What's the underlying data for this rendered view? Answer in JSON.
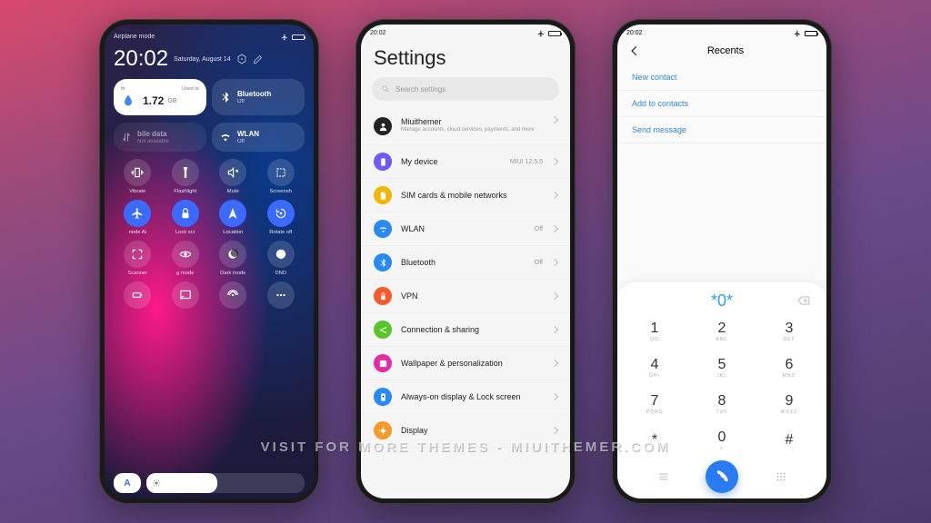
{
  "watermark": "VISIT FOR MORE THEMES - MIUITHEMER.COM",
  "qs": {
    "status_left": "Airplane mode",
    "clock": "20:02",
    "date": "Saturday, August 14",
    "data_tile": {
      "top_left": "th",
      "top_right": "Used to",
      "value": "1.72",
      "unit": "GB"
    },
    "bluetooth_tile": {
      "title": "Bluetooth",
      "sub": "Off"
    },
    "mobile_tile": {
      "title": "bile data",
      "sub": "Not available"
    },
    "wlan_tile": {
      "title": "WLAN",
      "sub": "Off"
    },
    "grid": [
      {
        "label": "Vibrate",
        "on": false,
        "icon": "vibrate"
      },
      {
        "label": "Flashlight",
        "on": false,
        "icon": "flashlight"
      },
      {
        "label": "Mute",
        "on": false,
        "icon": "mute"
      },
      {
        "label": "Screensh",
        "on": false,
        "icon": "screenshot"
      },
      {
        "label": "node   Ai",
        "on": true,
        "icon": "airplane"
      },
      {
        "label": "Lock scr",
        "on": true,
        "icon": "lock"
      },
      {
        "label": "Location",
        "on": true,
        "icon": "location"
      },
      {
        "label": "Rotate off",
        "on": true,
        "icon": "rotate"
      },
      {
        "label": "Scanner",
        "on": false,
        "icon": "scanner"
      },
      {
        "label": "g mode",
        "on": false,
        "icon": "eye"
      },
      {
        "label": "Dark mode",
        "on": false,
        "icon": "darkmode"
      },
      {
        "label": "DND",
        "on": false,
        "icon": "dnd"
      },
      {
        "label": "",
        "on": false,
        "icon": "battery"
      },
      {
        "label": "",
        "on": false,
        "icon": "cast"
      },
      {
        "label": "",
        "on": false,
        "icon": "hotspot"
      },
      {
        "label": "",
        "on": false,
        "icon": "more"
      }
    ],
    "auto_label": "A"
  },
  "settings": {
    "status_time": "20:02",
    "title": "Settings",
    "search_placeholder": "Search settings",
    "account": {
      "name": "Miuithemer",
      "sub": "Manage accounts, cloud services, payments, and more"
    },
    "rows": [
      {
        "label": "My device",
        "val": "MIUI 12.5.5",
        "color": "#6a5aff",
        "icon": "phone"
      },
      {
        "label": "SIM cards & mobile networks",
        "val": "",
        "color": "#f5b400",
        "icon": "sim"
      },
      {
        "label": "WLAN",
        "val": "Off",
        "color": "#2a8af5",
        "icon": "wifi"
      },
      {
        "label": "Bluetooth",
        "val": "Off",
        "color": "#2a8af5",
        "icon": "bluetooth"
      },
      {
        "label": "VPN",
        "val": "",
        "color": "#f55a2a",
        "icon": "vpn"
      },
      {
        "label": "Connection & sharing",
        "val": "",
        "color": "#5ac52a",
        "icon": "share"
      },
      {
        "label": "Wallpaper & personalization",
        "val": "",
        "color": "#e52aa5",
        "icon": "wallpaper"
      },
      {
        "label": "Always-on display & Lock screen",
        "val": "",
        "color": "#2a8af5",
        "icon": "aod"
      },
      {
        "label": "Display",
        "val": "",
        "color": "#f59a2a",
        "icon": "display"
      }
    ]
  },
  "dialer": {
    "status_time": "20:02",
    "title": "Recents",
    "options": [
      "New contact",
      "Add to contacts",
      "Send message"
    ],
    "entry": "*0*",
    "keys": [
      {
        "n": "1",
        "l": "QO"
      },
      {
        "n": "2",
        "l": "ABC"
      },
      {
        "n": "3",
        "l": "DEF"
      },
      {
        "n": "4",
        "l": "GHI"
      },
      {
        "n": "5",
        "l": "JKL"
      },
      {
        "n": "6",
        "l": "MNO"
      },
      {
        "n": "7",
        "l": "PQRS"
      },
      {
        "n": "8",
        "l": "TUV"
      },
      {
        "n": "9",
        "l": "WXYZ"
      },
      {
        "n": "*",
        "l": ""
      },
      {
        "n": "0",
        "l": "+"
      },
      {
        "n": "#",
        "l": ""
      }
    ]
  }
}
